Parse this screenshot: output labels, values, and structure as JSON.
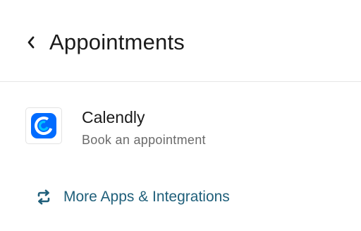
{
  "header": {
    "back_icon": "chevron-left-icon",
    "title": "Appointments"
  },
  "apps": [
    {
      "name": "Calendly",
      "description": "Book an appointment",
      "icon": "calendly-logo",
      "brand_color": "#006bff"
    }
  ],
  "more_apps": {
    "label": "More Apps & Integrations",
    "icon": "sync-arrows-icon",
    "color": "#1f5f7a"
  }
}
